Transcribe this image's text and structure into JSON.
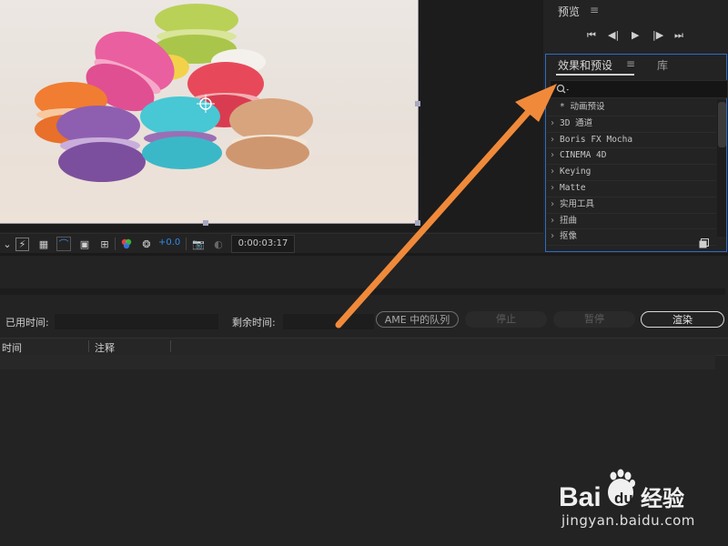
{
  "preview_panel": {
    "title": "预览",
    "menu_icon": "hamburger-menu-icon",
    "transport_icons": [
      "skip-to-start-icon",
      "step-back-icon",
      "play-icon",
      "step-forward-icon",
      "skip-to-end-icon"
    ]
  },
  "effects_panel": {
    "tabs": [
      {
        "label": "效果和预设",
        "active": true
      },
      {
        "label": "库",
        "active": false
      }
    ],
    "search_value": "",
    "items": [
      {
        "label": "* 动画预设",
        "has_arrow": false
      },
      {
        "label": "3D 通道",
        "has_arrow": true
      },
      {
        "label": "Boris FX Mocha",
        "has_arrow": true
      },
      {
        "label": "CINEMA 4D",
        "has_arrow": true
      },
      {
        "label": "Keying",
        "has_arrow": true
      },
      {
        "label": "Matte",
        "has_arrow": true
      },
      {
        "label": "实用工具",
        "has_arrow": true
      },
      {
        "label": "扭曲",
        "has_arrow": true
      },
      {
        "label": "抠像",
        "has_arrow": true
      }
    ]
  },
  "viewer_toolbar": {
    "zoom_offset": "+0.0",
    "timecode": "0:00:03:17",
    "icons": [
      "dropdown-chevron-icon",
      "fast-previews-icon",
      "transparency-grid-icon",
      "mask-path-icon",
      "region-of-interest-icon",
      "target-region-icon",
      "color-channels-icon",
      "exposure-reset-icon",
      "snapshot-camera-icon",
      "show-snapshot-icon"
    ]
  },
  "render_queue": {
    "elapsed_label": "已用时间:",
    "remaining_label": "剩余时间:",
    "ame_button": "AME 中的队列",
    "stop_button": "停止",
    "pause_button": "暂停",
    "render_button": "渲染",
    "columns": [
      "时间",
      "注释"
    ]
  },
  "watermark": {
    "brand": "Bai",
    "brand2": "du",
    "suffix": "经验",
    "url": "jingyan.baidu.com"
  },
  "colors": {
    "accent_blue": "#2d8ceb",
    "panel_border": "#2d6bc6",
    "arrow": "#f08a3a"
  }
}
